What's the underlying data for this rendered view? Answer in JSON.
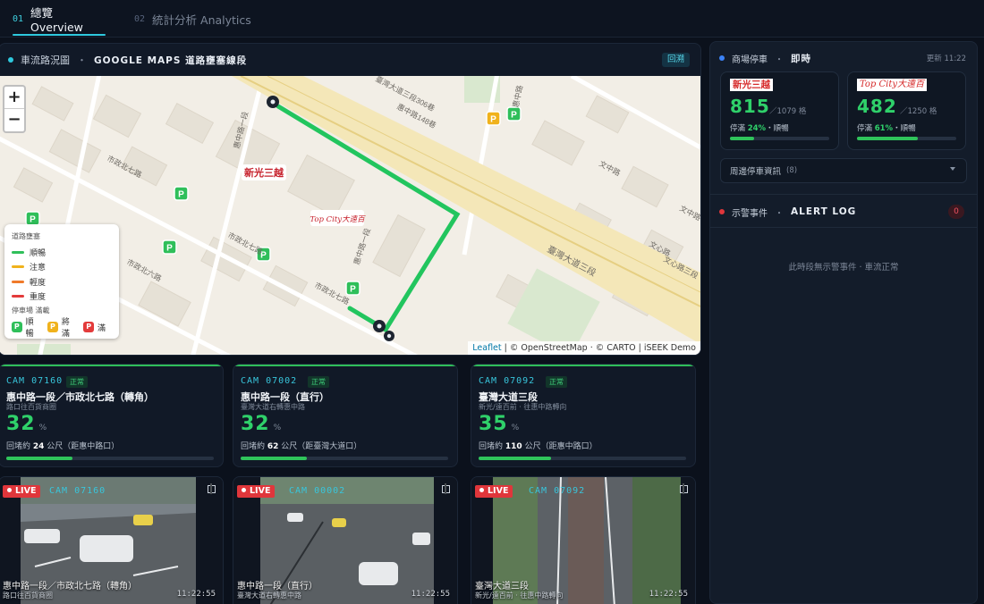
{
  "tabs": [
    {
      "num": "01",
      "label": "總覽 Overview"
    },
    {
      "num": "02",
      "label": "統計分析 Analytics"
    }
  ],
  "map_panel": {
    "title": "車流路況圖",
    "separator": "・",
    "subtitle": "GOOGLE MAPS 道路壅塞線段",
    "back_label": "回溯",
    "zoom_in": "+",
    "zoom_out": "−",
    "legend": {
      "title": "道路壅塞",
      "levels": [
        {
          "label": "順暢",
          "color": "#2fbf5a"
        },
        {
          "label": "注意",
          "color": "#f0b21c"
        },
        {
          "label": "輕度",
          "color": "#f07a2a"
        },
        {
          "label": "重度",
          "color": "#e33b3b"
        }
      ],
      "parking_title": "停車場 滿載",
      "parking": [
        {
          "icon": "P",
          "label": "順暢",
          "color": "#2fbf5a"
        },
        {
          "icon": "P",
          "label": "將滿",
          "color": "#f0b21c"
        },
        {
          "icon": "P",
          "label": "滿",
          "color": "#e33b3b"
        }
      ]
    },
    "streets": [
      "市政北七路",
      "惠中路一段",
      "臺灣大道三段",
      "市政北七路",
      "市政北七路",
      "市政北六路",
      "惠中路一段",
      "臺灣大道三段306巷",
      "惠中路148巷",
      "惠中路",
      "文中路",
      "文心路",
      "文心路三段",
      "文中路"
    ],
    "labels": {
      "shinkong": "新光三越",
      "topcity": "Top City大遠百"
    },
    "attribution": {
      "leaflet": "Leaflet",
      "rest": "| © OpenStreetMap · © CARTO | iSEEK Demo"
    }
  },
  "cams": [
    {
      "id": "CAM 07160",
      "status": "正常",
      "road": "惠中路一段／市政北七路（轉角）",
      "sub": "路口往百貨商圈",
      "pct": "32",
      "pct_unit": "%",
      "queue_prefix": "回堵約",
      "queue_num": "24",
      "queue_suffix": "公尺（距惠中路口）",
      "fill": 0.32
    },
    {
      "id": "CAM 07002",
      "status": "正常",
      "road": "惠中路一段（直行）",
      "sub": "臺灣大道右轉惠中路",
      "pct": "32",
      "pct_unit": "%",
      "queue_prefix": "回堵約",
      "queue_num": "62",
      "queue_suffix": "公尺（距臺灣大道口）",
      "fill": 0.32
    },
    {
      "id": "CAM 07092",
      "status": "正常",
      "road": "臺灣大道三段",
      "sub": "新光/遠百前 · 往惠中路轉向",
      "pct": "35",
      "pct_unit": "%",
      "queue_prefix": "回堵約",
      "queue_num": "110",
      "queue_suffix": "公尺（距惠中路口）",
      "fill": 0.35
    }
  ],
  "live": [
    {
      "tag": "LIVE",
      "cam": "CAM 07160",
      "road": "惠中路一段／市政北七路（轉角）",
      "sub": "路口往百貨商圈",
      "time": "11:22:55"
    },
    {
      "tag": "LIVE",
      "cam": "CAM 00002",
      "road": "惠中路一段（直行）",
      "sub": "臺灣大道右轉惠中路",
      "time": "11:22:55"
    },
    {
      "tag": "LIVE",
      "cam": "CAM 07092",
      "road": "臺灣大道三段",
      "sub": "新光/遠百前 · 往惠中路轉向",
      "time": "11:22:55"
    }
  ],
  "parking_panel": {
    "title": "商場停車",
    "separator": "・",
    "mode": "即時",
    "updated": "更新 11:22",
    "lots": [
      {
        "logo": "新光三越",
        "count": "815",
        "total": "／1079 格",
        "full_label": "停滿",
        "full_pct": "24%",
        "state": "・順暢",
        "fill": 0.24
      },
      {
        "logo": "Top City大遠百",
        "count": "482",
        "total": "／1250 格",
        "full_label": "停滿",
        "full_pct": "61%",
        "state": "・順暢",
        "fill": 0.61
      }
    ],
    "nearby_label": "周邊停車資訊",
    "nearby_count": "(8)"
  },
  "alert_panel": {
    "title": "示警事件",
    "separator": "・",
    "subtitle": "ALERT LOG",
    "count": "0",
    "empty": "此時段無示警事件 · 車流正常"
  },
  "colors": {
    "accent": "#2ec9de",
    "ok": "#2fd16a",
    "alert": "#e0363b"
  }
}
